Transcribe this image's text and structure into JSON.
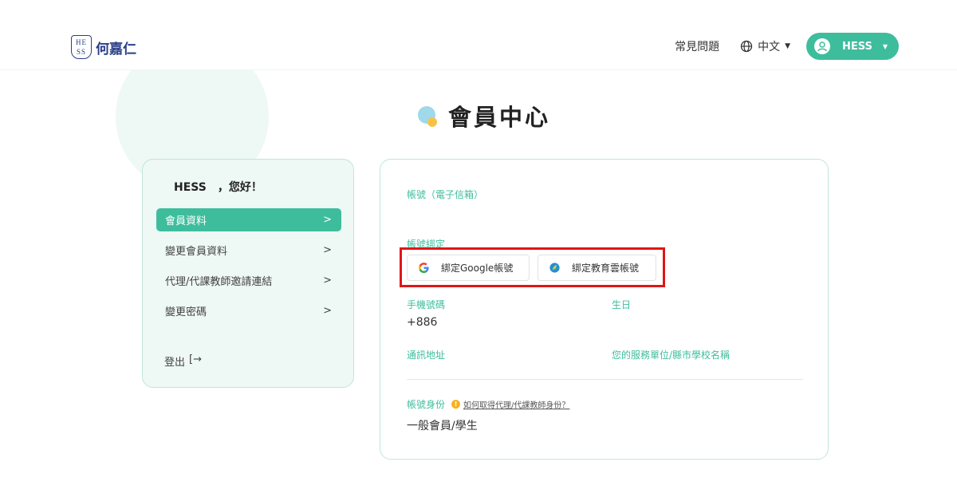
{
  "header": {
    "logo_text": "何嘉仁",
    "logo_mark": "HESS",
    "faq": "常見問題",
    "language": "中文",
    "user_name": "HESS"
  },
  "page": {
    "title": "會員中心"
  },
  "sidebar": {
    "greeting": "HESS　，您好！",
    "items": [
      {
        "label": "會員資料",
        "active": true
      },
      {
        "label": "變更會員資料",
        "active": false
      },
      {
        "label": "代理/代課教師邀請連結",
        "active": false
      },
      {
        "label": "變更密碼",
        "active": false
      }
    ],
    "logout": "登出",
    "logout_icon": "[→"
  },
  "account": {
    "email_label": "帳號（電子信箱）",
    "email_value": "",
    "binding_label": "帳號綁定",
    "bind_google": "綁定Google帳號",
    "bind_edu": "綁定教育雲帳號",
    "phone_label": "手機號碼",
    "phone_value": "+886",
    "birthday_label": "生日",
    "address_label": "通訊地址",
    "school_label": "您的服務單位/縣市學校名稱",
    "identity_label": "帳號身份",
    "identity_help": "如何取得代理/代課教師身份？",
    "identity_value": "一般會員/學生"
  },
  "colors": {
    "accent": "#3ebd9d",
    "panel_bg": "#eef8f5",
    "highlight": "#e01616"
  },
  "icons": {
    "language": "globe-icon",
    "user": "user-avatar-icon",
    "google": "google-icon",
    "edu": "edu-cloud-icon"
  }
}
